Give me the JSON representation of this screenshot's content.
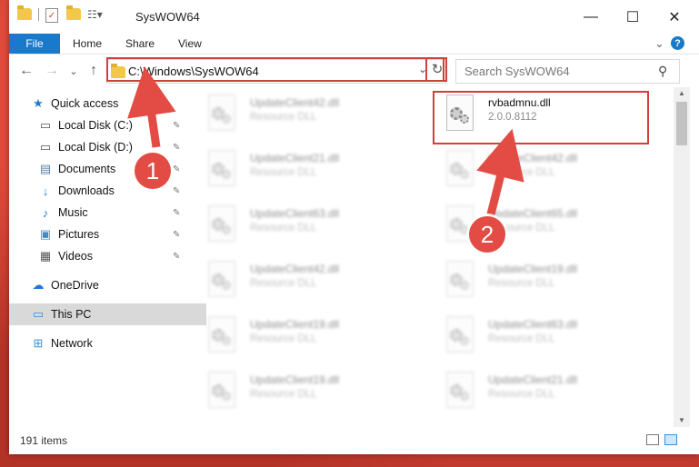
{
  "window": {
    "title": "SysWOW64",
    "controls": {
      "minimize": "—",
      "maximize": "☐",
      "close": "✕"
    }
  },
  "ribbon": {
    "file_tab": "File",
    "tabs": [
      "Home",
      "Share",
      "View"
    ],
    "help": "?",
    "collapse": "⌄"
  },
  "nav": {
    "back": "←",
    "forward": "→",
    "recent": "⌄",
    "up": "↑",
    "address": "C:\\Windows\\SysWOW64",
    "address_dropdown": "⌄",
    "refresh": "↻",
    "search_placeholder": "Search SysWOW64",
    "search_icon": "⚲"
  },
  "sidebar": {
    "items": [
      {
        "label": "Quick access",
        "icon": "star-icon",
        "glyph": "★",
        "pinned": false
      },
      {
        "label": "Local Disk (C:)",
        "icon": "drive-icon",
        "glyph": "▭",
        "pinned": true
      },
      {
        "label": "Local Disk (D:)",
        "icon": "drive-icon",
        "glyph": "▭",
        "pinned": true
      },
      {
        "label": "Documents",
        "icon": "documents-icon",
        "glyph": "▤",
        "pinned": true
      },
      {
        "label": "Downloads",
        "icon": "download-icon",
        "glyph": "↓",
        "pinned": true
      },
      {
        "label": "Music",
        "icon": "music-icon",
        "glyph": "♪",
        "pinned": true
      },
      {
        "label": "Pictures",
        "icon": "pictures-icon",
        "glyph": "▣",
        "pinned": true
      },
      {
        "label": "Videos",
        "icon": "videos-icon",
        "glyph": "▦",
        "pinned": true
      },
      {
        "label": "OneDrive",
        "icon": "cloud-icon",
        "glyph": "☁",
        "pinned": false
      },
      {
        "label": "This PC",
        "icon": "computer-icon",
        "glyph": "▭",
        "pinned": false
      },
      {
        "label": "Network",
        "icon": "network-icon",
        "glyph": "⊞",
        "pinned": false
      }
    ],
    "pin_glyph": "📌"
  },
  "files": {
    "left_column": [
      {
        "name": "UpdateClient42.dll",
        "desc": "Resource DLL"
      },
      {
        "name": "UpdateClient21.dll",
        "desc": "Resource DLL"
      },
      {
        "name": "UpdateClient63.dll",
        "desc": "Resource DLL"
      },
      {
        "name": "UpdateClient42.dll",
        "desc": "Resource DLL"
      },
      {
        "name": "UpdateClient19.dll",
        "desc": "Resource DLL"
      },
      {
        "name": "UpdateClient19.dll",
        "desc": "Resource DLL"
      }
    ],
    "right_column": [
      {
        "name": "rvbadmnu.dll",
        "desc": "2.0.0.8112"
      },
      {
        "name": "UpdateClient42.dll",
        "desc": "Resource DLL"
      },
      {
        "name": "UpdateClient65.dll",
        "desc": "Resource DLL"
      },
      {
        "name": "UpdateClient19.dll",
        "desc": "Resource DLL"
      },
      {
        "name": "UpdateClient63.dll",
        "desc": "Resource DLL"
      },
      {
        "name": "UpdateClient21.dll",
        "desc": "Resource DLL"
      }
    ]
  },
  "status": {
    "item_count": "191 items"
  },
  "annotations": {
    "step1": "1",
    "step2": "2",
    "color": "#e24c44"
  }
}
